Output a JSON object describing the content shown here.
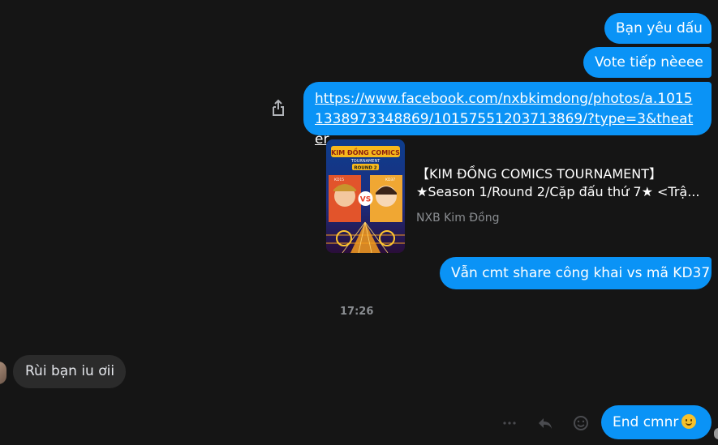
{
  "conversation": {
    "messages": [
      {
        "direction": "outgoing",
        "text": "Bạn yêu dấu"
      },
      {
        "direction": "outgoing",
        "text": "Vote tiếp nèeee"
      },
      {
        "direction": "outgoing",
        "text": "https://www.facebook.com/nxbkimdong/photos/a.10151338973348869/10157551203713869/?type=3&theater"
      },
      {
        "direction": "outgoing",
        "text": "Vẫn cmt share công khai vs mã KD37"
      },
      {
        "direction": "incoming",
        "text": "Rùi bạn iu ơii"
      },
      {
        "direction": "outgoing",
        "text": "End cmnr"
      }
    ],
    "link_preview": {
      "title_line1": "【KIM ĐỒNG COMICS TOURNAMENT】",
      "title_line2": "★Season 1/Round 2/Cặp đấu thứ 7★ <Trậ...",
      "source": "NXB Kim Đồng",
      "thumbnail": {
        "banner_text": "KIM ĐỒNG COMICS",
        "sub_text": "TOURNAMENT",
        "round_text": "ROUND 2",
        "left_tag": "KD15",
        "right_tag": "KD37",
        "vs_text": "VS"
      }
    },
    "timestamp": "17:26",
    "colors": {
      "background": "#151515",
      "outgoing_bubble": "#0a93f6",
      "incoming_bubble": "#2b2b2b"
    },
    "icons": {
      "share": "share-icon",
      "more": "more-icon",
      "reply": "reply-icon",
      "react": "emoji-reaction-icon",
      "emoji_in_message": "smiling-face-emoji"
    }
  }
}
